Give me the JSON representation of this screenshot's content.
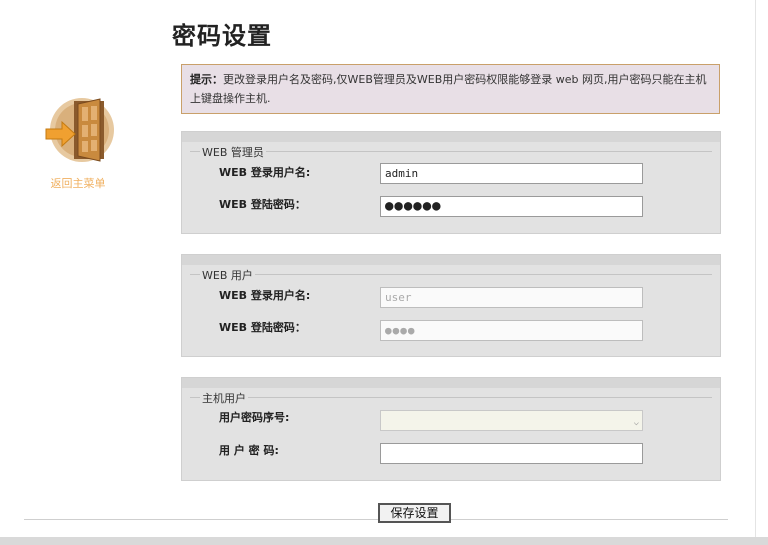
{
  "page": {
    "title": "密码设置"
  },
  "tip": {
    "label": "提示：",
    "text": "更改登录用户名及密码,仅WEB管理员及WEB用户密码权限能够登录 web 网页,用户密码只能在主机上键盘操作主机."
  },
  "back": {
    "label": "返回主菜单",
    "icon": "door-exit-icon"
  },
  "web_admin": {
    "legend": "WEB 管理员",
    "username_label": "WEB 登录用户名:",
    "username_value": "admin",
    "password_label": "WEB 登陆密码：",
    "password_mask": "●●●●●●"
  },
  "web_user": {
    "legend": "WEB 用户",
    "username_label": "WEB 登录用户名:",
    "username_value": "user",
    "password_label": "WEB 登陆密码：",
    "password_mask": "●●●●"
  },
  "host_user": {
    "legend": "主机用户",
    "serial_label": "用户密码序号:",
    "serial_value": "",
    "password_label": "用 户 密 码:",
    "password_value": ""
  },
  "actions": {
    "save_label": "保存设置"
  },
  "colors": {
    "tip_bg": "#e8dfe6",
    "tip_border": "#c9a06a",
    "panel_bg": "#e2e2e2",
    "back_label": "#f0b060"
  }
}
